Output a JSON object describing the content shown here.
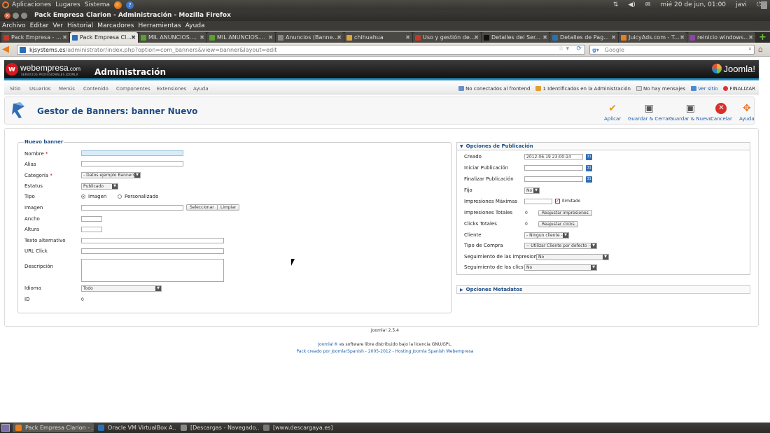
{
  "top_panel": {
    "menus": [
      "Aplicaciones",
      "Lugares",
      "Sistema"
    ],
    "clock": "mié 20 de jun, 01:00",
    "user": "javi"
  },
  "window": {
    "title": "Pack Empresa Clarion - Administración - Mozilla Firefox"
  },
  "menubar": [
    "Archivo",
    "Editar",
    "Ver",
    "Historial",
    "Marcadores",
    "Herramientas",
    "Ayuda"
  ],
  "tabs": [
    {
      "label": "Pack Empresa - ...",
      "color": "#c0392b"
    },
    {
      "label": "Pack Empresa Cl...",
      "color": "#2b70b7",
      "active": true
    },
    {
      "label": "MIL ANUNCIOS....",
      "color": "#5aa02c"
    },
    {
      "label": "MIL ANUNCIOS....",
      "color": "#5aa02c"
    },
    {
      "label": "Anuncios (Banne...",
      "color": "#888888"
    },
    {
      "label": "chihuahua",
      "color": "#d9a441"
    },
    {
      "label": "Uso y gestión de...",
      "color": "#c0392b"
    },
    {
      "label": "Detalles del Ser...",
      "color": "#111111"
    },
    {
      "label": "Detalles de Pag...",
      "color": "#2b70b7"
    },
    {
      "label": "JuicyAds.com - T...",
      "color": "#e67e22"
    },
    {
      "label": "reinicio windows...",
      "color": "#8e44ad"
    }
  ],
  "nav": {
    "url_host": "kjsystems.es",
    "url_path": "/administrator/index.php?option=com_banners&view=banner&layout=edit",
    "search_placeholder": "Google"
  },
  "joomla": {
    "brand": "webempresa",
    "brand_suffix": ".com",
    "brand_tagline": "SERVICIOS PROFESIONALES JOOMLA",
    "admin_title": "Administración",
    "joomla_logo": "Joomla!",
    "menu": [
      "Sitio",
      "Usuarios",
      "Menús",
      "Contenido",
      "Componentes",
      "Extensiones",
      "Ayuda"
    ],
    "status": {
      "frontend": "No conectados al frontend",
      "admin": "1 Identificados en la Administración",
      "messages": "No hay mensajes",
      "view_site": "Ver sitio",
      "logout": "FINALIZAR"
    }
  },
  "toolbar": {
    "title": "Gestor de Banners: banner Nuevo",
    "apply": "Aplicar",
    "save_close": "Guardar & Cerrar",
    "save_new": "Guardar & Nuevo",
    "cancel": "Cancelar",
    "help": "Ayuda"
  },
  "form": {
    "legend": "Nuevo banner",
    "name_label": "Nombre",
    "alias_label": "Alias",
    "category_label": "Categoría",
    "category_value": "- Datos ejemplo Banners",
    "status_label": "Estatus",
    "status_value": "Publicado",
    "type_label": "Tipo",
    "type_image": "Imagen",
    "type_custom": "Personalizado",
    "image_label": "Imagen",
    "select_btn": "Seleccionar",
    "clear_btn": "Limpiar",
    "width_label": "Ancho",
    "height_label": "Altura",
    "alt_label": "Texto alternativo",
    "url_label": "URL Click",
    "desc_label": "Descripción",
    "lang_label": "Idioma",
    "lang_value": "Todo",
    "id_label": "ID",
    "id_value": "0",
    "required_mark": "*"
  },
  "publishing": {
    "header": "Opciones de Publicación",
    "created_label": "Creado",
    "created_value": "2012-06-19 23:00:14",
    "start_label": "Iniciar Publicación",
    "end_label": "Finalizar Publicación",
    "sticky_label": "Fijo",
    "sticky_value": "No",
    "max_imp_label": "Impresiones Máximas",
    "unlimited_label": "Ilimitado",
    "total_imp_label": "Impresiones Totales",
    "total_imp_value": "0",
    "reset_imp_btn": "Reajustar impresiones",
    "total_clicks_label": "Clicks Totales",
    "total_clicks_value": "0",
    "reset_clicks_btn": "Reajustar clicks",
    "client_label": "Cliente",
    "client_value": "- Ningun cliente -",
    "purchase_label": "Tipo de Compra",
    "purchase_value": "-- Utilizar Cliente por defecto --",
    "track_imp_label": "Seguimiento de las impresiones",
    "track_imp_value": "No",
    "track_clicks_label": "Seguimiento de los clics",
    "track_clicks_value": "No",
    "cal_icon": "31"
  },
  "metadata": {
    "header": "Opciones Metadatos"
  },
  "footer": {
    "version": "Joomla! 2.5.4",
    "license_link": "Joomla!®",
    "license_text": "es software libre distribuido bajo la licencia GNU/GPL.",
    "credit": "Pack creado por Joomla!Spanish - 2005-2012 - Hosting Joomla Spanish Webempresa"
  },
  "taskbar": [
    {
      "label": "Pack Empresa Clarion - ...",
      "color": "#e67e22",
      "active": true
    },
    {
      "label": "Oracle VM VirtualBox A...",
      "color": "#2b70b7"
    },
    {
      "label": "[Descargas - Navegado...",
      "color": "#888888"
    },
    {
      "label": "[www.descargaya.es]",
      "color": "#777777"
    }
  ]
}
